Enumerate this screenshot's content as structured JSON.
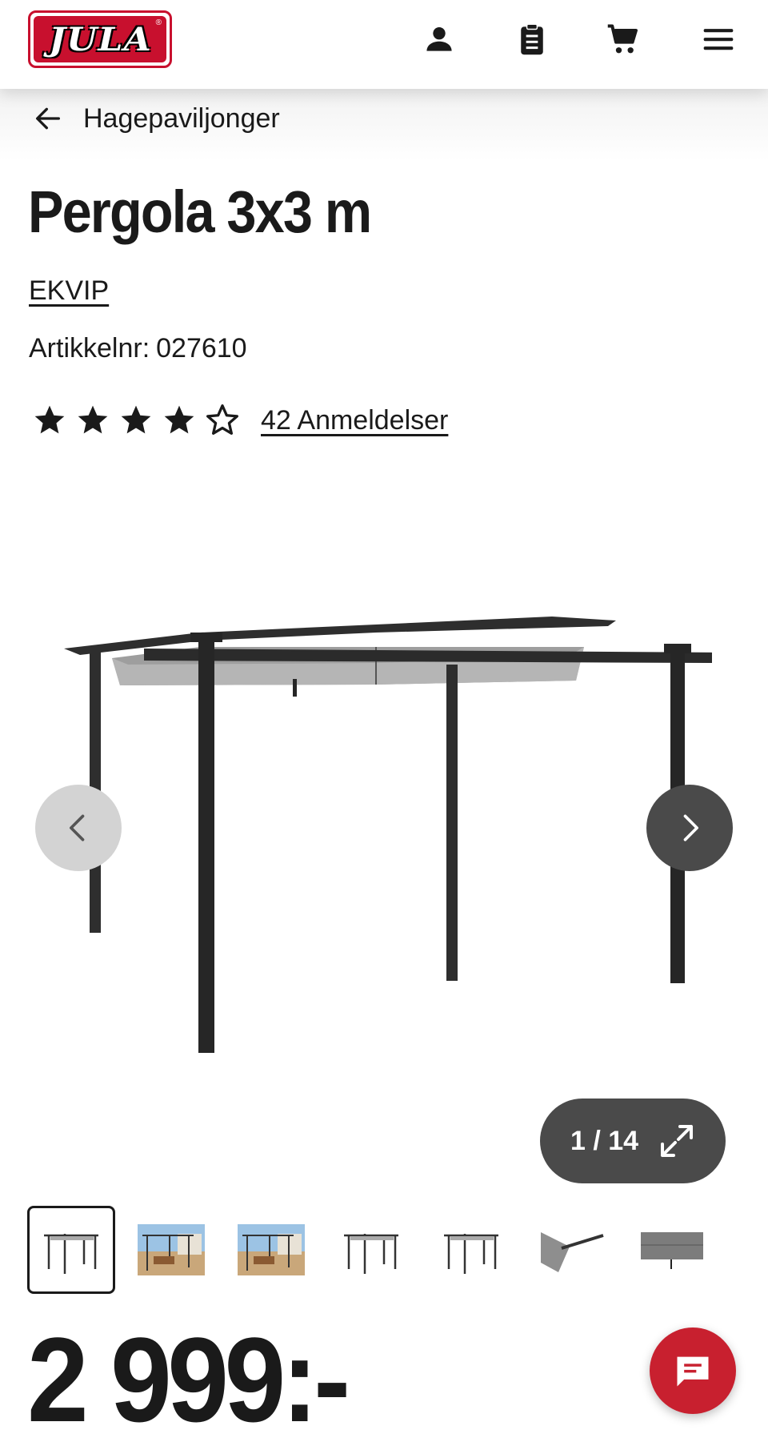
{
  "header": {
    "logo_text": "JULA",
    "logo_reg": "®",
    "icons": [
      "account-icon",
      "shopping-list-icon",
      "cart-icon",
      "menu-icon"
    ]
  },
  "breadcrumb": {
    "label": "Hagepaviljonger",
    "icon": "arrow-left-icon"
  },
  "product": {
    "title": "Pergola 3x3 m",
    "brand": "EKVIP",
    "article_label": "Artikkelnr:",
    "article_number": "027610",
    "rating": 4,
    "rating_max": 5,
    "reviews_label": "42 Anmeldelser",
    "price": "2 999:-"
  },
  "gallery": {
    "counter": "1 / 14",
    "current_index": 1,
    "total": 14,
    "expand_icon": "expand-icon",
    "prev_icon": "chevron-left-icon",
    "next_icon": "chevron-right-icon",
    "thumbnails": [
      "pergola-frame",
      "pergola-terrace",
      "pergola-terrace",
      "pergola-frame",
      "pergola-frame",
      "canopy-detail",
      "canopy-fabric"
    ]
  },
  "chat": {
    "icon": "chat-icon"
  },
  "colors": {
    "brand_red": "#c8102e",
    "dark_gray": "#4a4a4a",
    "light_gray": "#d3d3d3",
    "text": "#1a1a1a"
  }
}
